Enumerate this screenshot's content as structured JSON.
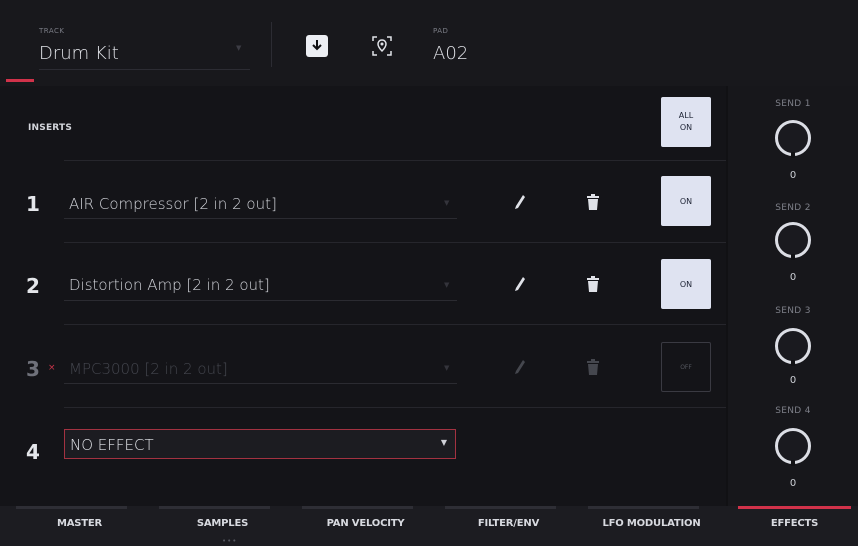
{
  "header": {
    "track_label": "TRACK",
    "track_value": "Drum Kit",
    "pad_label": "PAD",
    "pad_value": "A02"
  },
  "inserts": {
    "title": "INSERTS",
    "all_on_line1": "ALL",
    "all_on_line2": "ON",
    "slots": [
      {
        "num": "1",
        "name": "AIR Compressor [2 in 2 out]",
        "state": "ON"
      },
      {
        "num": "2",
        "name": "Distortion Amp [2 in 2 out]",
        "state": "ON"
      },
      {
        "num": "3",
        "name": "MPC3000 [2 in 2 out]",
        "state": "OFF",
        "muted_mark": "×"
      },
      {
        "num": "4",
        "name": "NO EFFECT"
      }
    ]
  },
  "sends": [
    {
      "label": "SEND 1",
      "value": "0"
    },
    {
      "label": "SEND 2",
      "value": "0"
    },
    {
      "label": "SEND 3",
      "value": "0"
    },
    {
      "label": "SEND 4",
      "value": "0"
    }
  ],
  "tabs": [
    "MASTER",
    "SAMPLES",
    "PAN VELOCITY",
    "FILTER/ENV",
    "LFO MODULATION",
    "EFFECTS"
  ],
  "active_tab": "EFFECTS",
  "icons": {
    "save": "save-down-arrow-icon",
    "locate": "locate-pad-icon",
    "edit": "pencil-icon",
    "delete": "trash-icon",
    "dropdown": "caret-down-icon"
  },
  "colors": {
    "accent": "#d1324a",
    "on_button": "#dfe3f1",
    "background": "#111114"
  }
}
